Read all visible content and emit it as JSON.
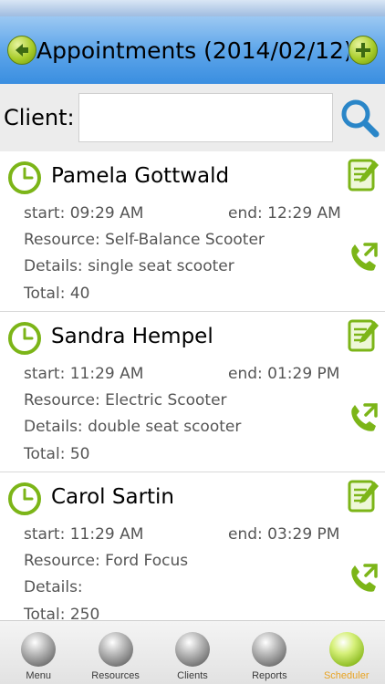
{
  "header": {
    "title": "Appointments (2014/02/12)",
    "prev_icon": "arrow-left-icon",
    "add_icon": "plus-icon"
  },
  "client": {
    "label": "Client:",
    "input_value": "",
    "search_icon": "search-icon"
  },
  "appointments": [
    {
      "name": "Pamela Gottwald",
      "start": "start: 09:29 AM",
      "end": "end: 12:29 AM",
      "resource": "Resource: Self-Balance Scooter",
      "details": "Details: single seat scooter",
      "total": "Total: 40"
    },
    {
      "name": "Sandra Hempel",
      "start": "start: 11:29 AM",
      "end": "end: 01:29 PM",
      "resource": "Resource: Electric Scooter",
      "details": "Details: double seat scooter",
      "total": "Total: 50"
    },
    {
      "name": "Carol Sartin",
      "start": "start: 11:29 AM",
      "end": "end: 03:29 PM",
      "resource": "Resource: Ford Focus",
      "details": "Details:",
      "total": "Total: 250"
    }
  ],
  "nav": [
    {
      "label": "Menu",
      "active": false
    },
    {
      "label": "Resources",
      "active": false
    },
    {
      "label": "Clients",
      "active": false
    },
    {
      "label": "Reports",
      "active": false
    },
    {
      "label": "Scheduler",
      "active": true
    }
  ],
  "colors": {
    "header_blue": "#5ea6ea",
    "accent_green": "#7cb518",
    "active_nav_label": "#e8a322",
    "search_blue": "#2a86c8"
  }
}
